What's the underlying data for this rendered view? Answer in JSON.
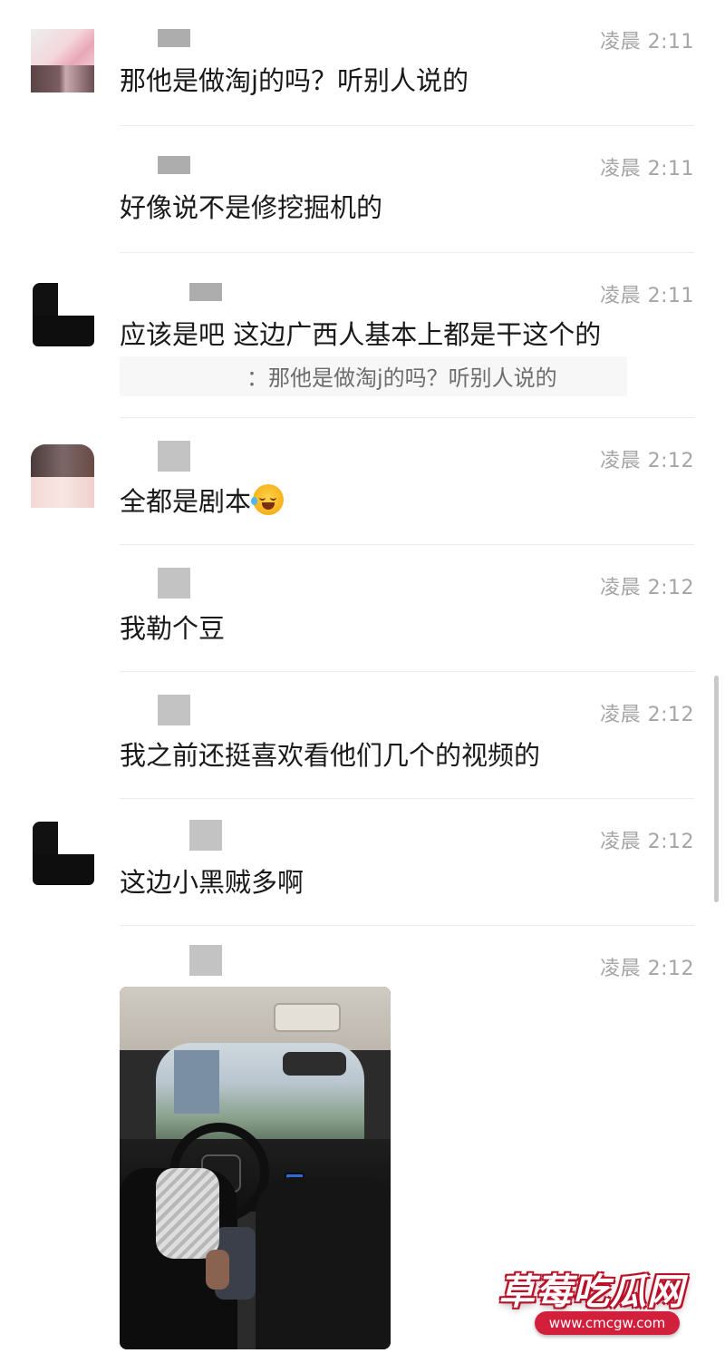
{
  "messages": [
    {
      "time": "凌晨 2:11",
      "text": "那他是做淘j的吗？听别人说的"
    },
    {
      "time": "凌晨 2:11",
      "text": "好像说不是修挖掘机的"
    },
    {
      "time": "凌晨 2:11",
      "text": "应该是吧 这边广西人基本上都是干这个的",
      "quote": "：那他是做淘j的吗？听别人说的"
    },
    {
      "time": "凌晨 2:12",
      "text": "全都是剧本"
    },
    {
      "time": "凌晨 2:12",
      "text": "我勒个豆"
    },
    {
      "time": "凌晨 2:12",
      "text": "我之前还挺喜欢看他们几个的视频的"
    },
    {
      "time": "凌晨 2:12",
      "text": "这边小黑贼多啊"
    },
    {
      "time": "凌晨 2:12"
    }
  ],
  "watermark": {
    "title": "草莓吃瓜网",
    "url": "www.cmcgw.com"
  },
  "icons": [
    "crying-laughing-emoji-icon"
  ]
}
